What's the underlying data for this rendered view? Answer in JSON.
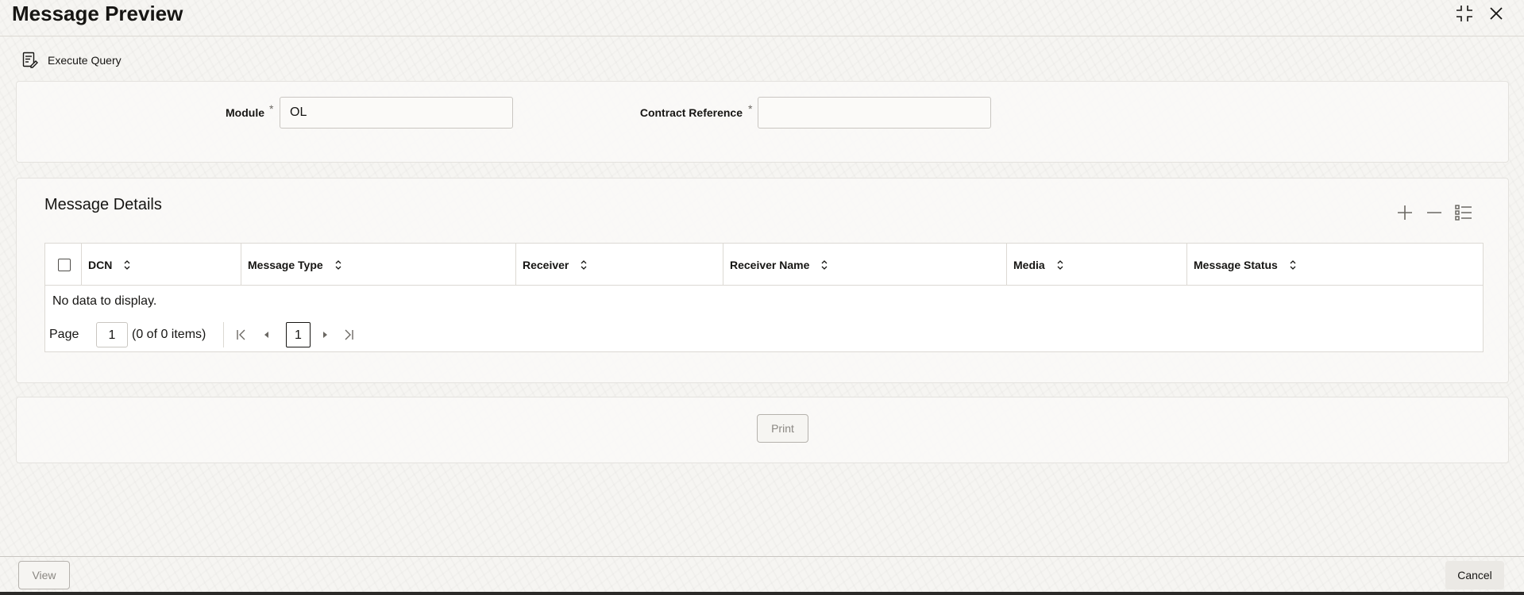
{
  "window": {
    "title": "Message Preview"
  },
  "toolbar": {
    "execute_query_label": "Execute Query"
  },
  "form": {
    "module_label": "Module",
    "module_required": "*",
    "module_value": "OL",
    "contract_reference_label": "Contract Reference",
    "contract_reference_required": "*",
    "contract_reference_value": ""
  },
  "message_details": {
    "title": "Message Details",
    "columns": [
      "DCN",
      "Message Type",
      "Receiver",
      "Receiver Name",
      "Media",
      "Message Status"
    ],
    "empty_text": "No data to display.",
    "pagination": {
      "page_label": "Page",
      "page_value": "1",
      "summary": "(0 of 0 items)",
      "current_page": "1"
    }
  },
  "actions": {
    "print_label": "Print"
  },
  "footer": {
    "view_label": "View",
    "cancel_label": "Cancel"
  },
  "icons": {
    "maximize": "maximize-icon",
    "close": "close-icon",
    "execute_query": "execute-query-icon",
    "add_row": "plus-icon",
    "delete_row": "minus-icon",
    "single_record_view": "list-view-icon",
    "sort": "sort-icon",
    "first_page": "first-page-icon",
    "previous_page": "previous-page-icon",
    "next_page": "next-page-icon",
    "last_page": "last-page-icon"
  }
}
